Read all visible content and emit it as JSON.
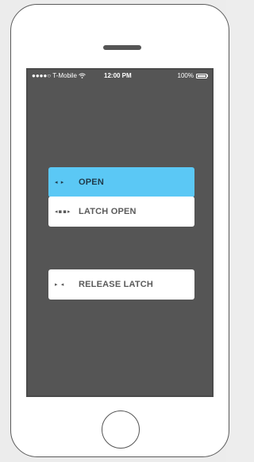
{
  "status_bar": {
    "carrier": "●●●●○ T-Mobile",
    "wifi_icon": "wifi-icon",
    "time": "12:00 PM",
    "battery_percent": "100%"
  },
  "buttons": [
    {
      "icon": "◂ ▸",
      "label": "OPEN",
      "state": "active"
    },
    {
      "icon": "◂▪▪▸",
      "label": "LATCH OPEN",
      "state": "normal"
    },
    {
      "icon": "▸ ◂",
      "label": "RELEASE LATCH",
      "state": "normal"
    }
  ],
  "colors": {
    "screen_bg": "#555555",
    "active_button": "#5bc8f5",
    "normal_button": "#ffffff"
  }
}
